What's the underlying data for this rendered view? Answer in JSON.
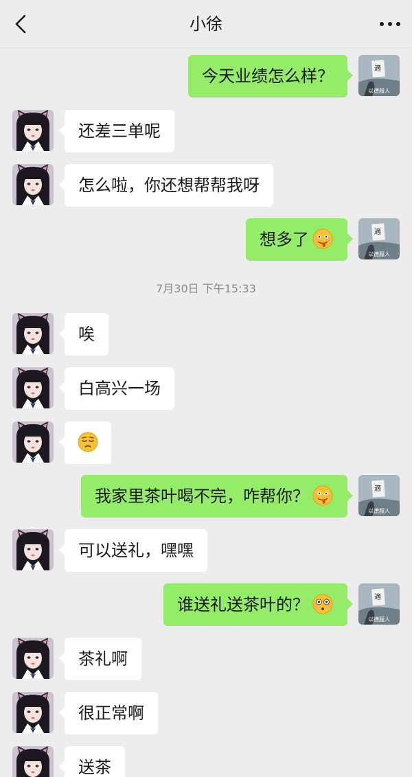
{
  "header": {
    "title": "小徐"
  },
  "timestamp": "7月30日 下午15:33",
  "my_avatar_text": "以德服人",
  "messages": [
    {
      "text": "今天业绩怎么样？"
    },
    {
      "text": "还差三单呢"
    },
    {
      "text": "怎么啦，你还想帮帮我呀"
    },
    {
      "text": "想多了",
      "emoji": "drooling-face-emoji"
    },
    {
      "text": "唉"
    },
    {
      "text": "白高兴一场"
    },
    {
      "text": "",
      "emoji": "pensive-face-emoji"
    },
    {
      "text": "我家里茶叶喝不完，咋帮你？",
      "emoji": "drooling-face-emoji"
    },
    {
      "text": "可以送礼，嘿嘿"
    },
    {
      "text": "谁送礼送茶叶的？",
      "emoji": "flushed-face-emoji"
    },
    {
      "text": "茶礼啊"
    },
    {
      "text": "很正常啊"
    },
    {
      "text": "送茶"
    }
  ],
  "colors": {
    "background": "#ededed",
    "incoming_bubble": "#ffffff",
    "outgoing_bubble": "#95ec69",
    "timestamp_text": "#8a8a8a"
  }
}
